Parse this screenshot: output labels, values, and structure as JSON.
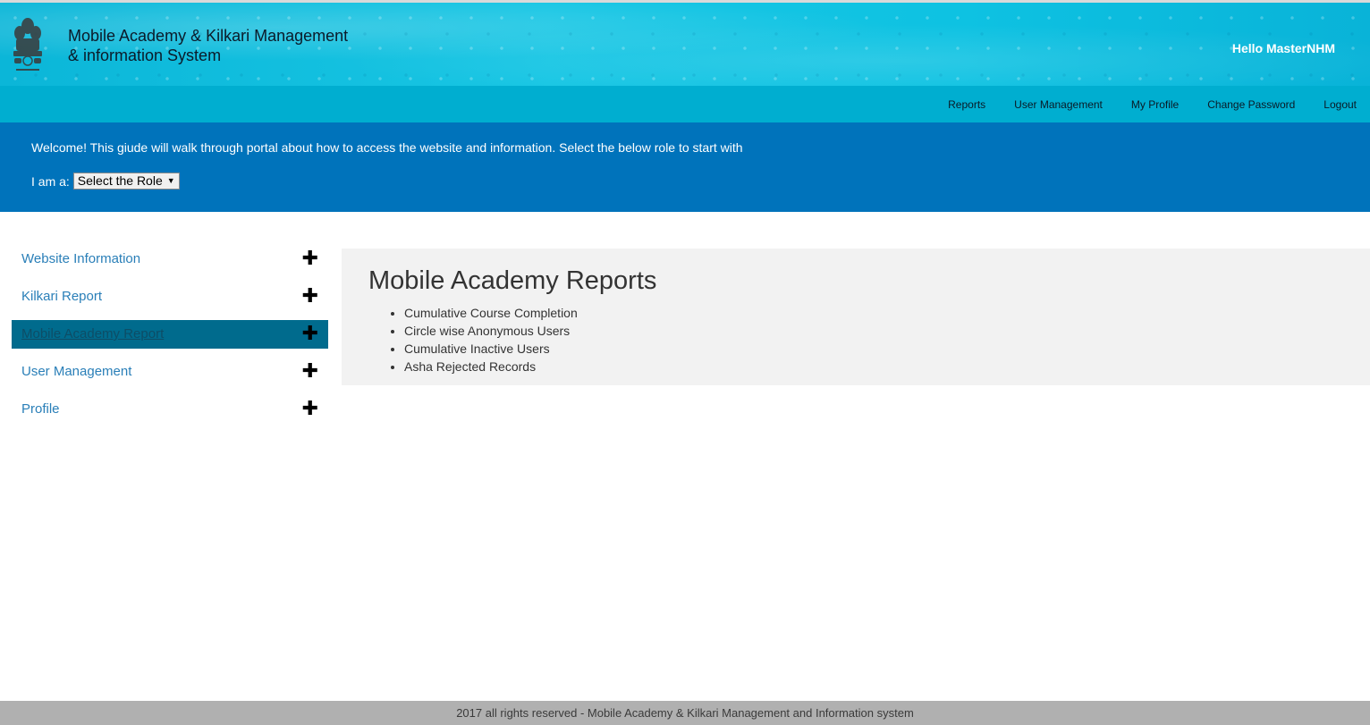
{
  "header": {
    "emblem_icon": "national-emblem-icon",
    "title_line1": "Mobile Academy & Kilkari Management",
    "title_line2": "& information System",
    "greeting": "Hello MasterNHM"
  },
  "nav": {
    "items": [
      {
        "label": "Reports"
      },
      {
        "label": "User Management"
      },
      {
        "label": "My Profile"
      },
      {
        "label": "Change Password"
      },
      {
        "label": "Logout"
      }
    ]
  },
  "welcome": {
    "text": "Welcome! This giude will walk through portal about how to access the website and information. Select the below role to start with",
    "role_label": "I am a:",
    "role_select_value": "Select the Role"
  },
  "sidebar": {
    "items": [
      {
        "label": "Website Information",
        "icon": "plus-icon"
      },
      {
        "label": "Kilkari Report",
        "icon": "plus-icon"
      },
      {
        "label": "Mobile Academy Report",
        "icon": "plus-icon",
        "active": true
      },
      {
        "label": "User Management",
        "icon": "plus-icon"
      },
      {
        "label": "Profile",
        "icon": "plus-icon"
      }
    ]
  },
  "main": {
    "heading": "Mobile Academy Reports",
    "reports": [
      "Cumulative Course Completion",
      "Circle wise Anonymous Users",
      "Cumulative Inactive Users",
      "Asha Rejected Records"
    ]
  },
  "footer": {
    "text": "2017 all rights reserved - Mobile Academy & Kilkari Management and Information system"
  },
  "colors": {
    "header_bg": "#18c6e4",
    "navbar_bg": "#00aed0",
    "welcome_bg": "#0073bb",
    "sidebar_active_bg": "#006b8d",
    "link_color": "#2a7fb8",
    "content_bg": "#f2f2f2",
    "footer_bg": "#b0b0b0"
  }
}
